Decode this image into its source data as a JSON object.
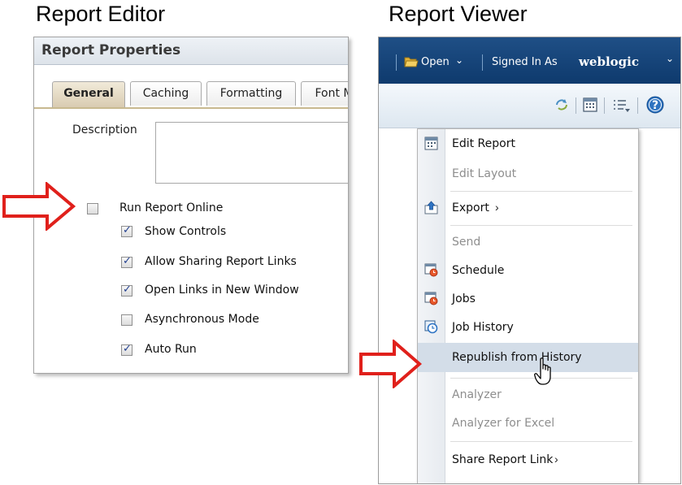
{
  "captions": {
    "editor": "Report Editor",
    "viewer": "Report Viewer"
  },
  "editor": {
    "title": "Report Properties",
    "tabs": [
      "General",
      "Caching",
      "Formatting",
      "Font M"
    ],
    "description_label": "Description",
    "description_value": "",
    "options": [
      {
        "label": "Run Report Online",
        "checked": false
      },
      {
        "label": "Show Controls",
        "checked": true
      },
      {
        "label": "Allow Sharing Report Links",
        "checked": true
      },
      {
        "label": "Open Links in New Window",
        "checked": true
      },
      {
        "label": "Asynchronous Mode",
        "checked": false
      },
      {
        "label": "Auto Run",
        "checked": true
      }
    ]
  },
  "viewer": {
    "open_label": "Open",
    "signed_in_label": "Signed In As",
    "user": "weblogic",
    "menu": [
      {
        "label": "Edit Report",
        "enabled": true,
        "icon": "calendar-icon"
      },
      {
        "label": "Edit Layout",
        "enabled": false
      },
      {
        "label": "Export",
        "enabled": true,
        "icon": "export-icon",
        "submenu": true
      },
      {
        "label": "Send",
        "enabled": false
      },
      {
        "label": "Schedule",
        "enabled": true,
        "icon": "schedule-icon"
      },
      {
        "label": "Jobs",
        "enabled": true,
        "icon": "jobs-icon"
      },
      {
        "label": "Job History",
        "enabled": true,
        "icon": "job-history-icon"
      },
      {
        "label": "Republish from History",
        "enabled": true,
        "highlighted": true
      },
      {
        "label": "Analyzer",
        "enabled": false
      },
      {
        "label": "Analyzer for Excel",
        "enabled": false
      },
      {
        "label": "Share Report Link",
        "enabled": true,
        "submenu": true
      }
    ]
  },
  "colors": {
    "arrow": "#e0201b",
    "header_bar": "#1a4a80",
    "menu_highlight": "#d3dde8"
  }
}
